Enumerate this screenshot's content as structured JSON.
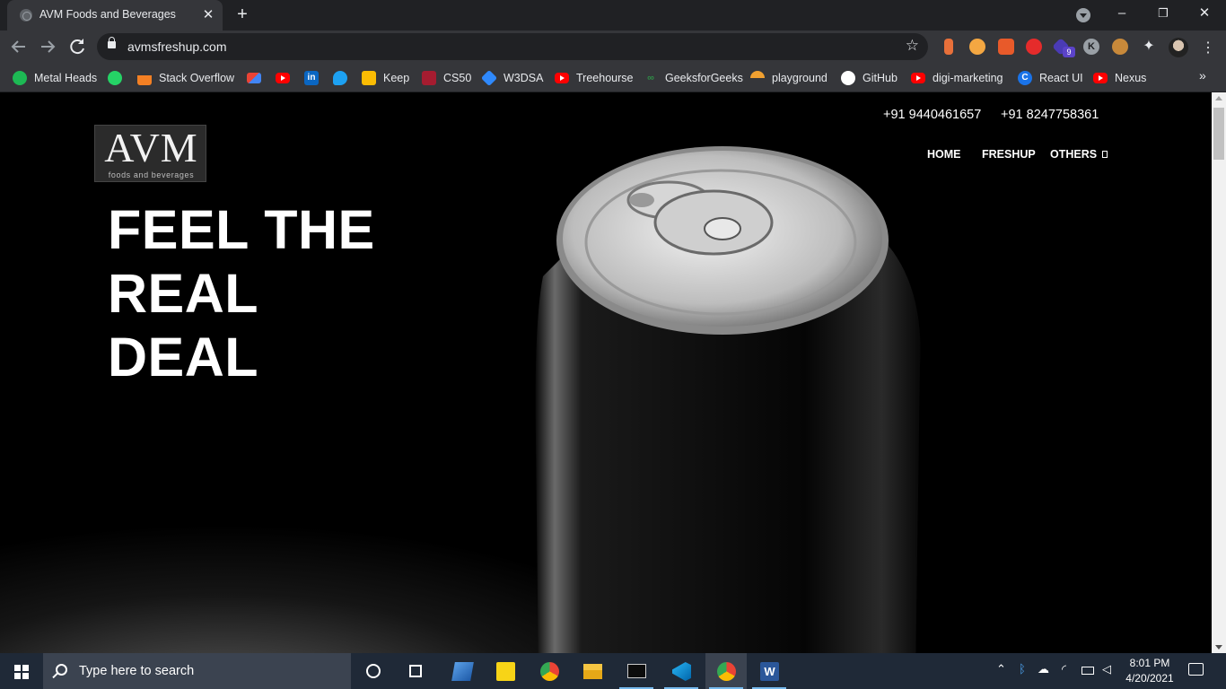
{
  "browser": {
    "tab_title": "AVM Foods and Beverages",
    "tab_close": "✕",
    "new_tab": "+",
    "url": "avmsfreshup.com",
    "extension_badge": "9",
    "extension_k": "K",
    "window_controls": [
      "–",
      "❐",
      "✕"
    ],
    "nav_icons": [
      "arrow-left-icon",
      "arrow-right-icon",
      "reload-icon"
    ]
  },
  "bookmarks": [
    {
      "label": "Metal Heads",
      "icon": "spotify-icon",
      "color": "#1db954"
    },
    {
      "label": "",
      "icon": "whatsapp-icon",
      "color": "#25d366"
    },
    {
      "label": "Stack Overflow",
      "icon": "stackoverflow-icon",
      "color": "#f48024"
    },
    {
      "label": "",
      "icon": "gmail-icon",
      "color": "#ea4335"
    },
    {
      "label": "",
      "icon": "youtube-icon",
      "color": "#ff0000"
    },
    {
      "label": "",
      "icon": "linkedin-icon",
      "color": "#0a66c2"
    },
    {
      "label": "",
      "icon": "twitter-icon",
      "color": "#1da1f2"
    },
    {
      "label": "Keep",
      "icon": "keep-icon",
      "color": "#fbbc04"
    },
    {
      "label": "CS50",
      "icon": "cs50-icon",
      "color": "#a51c30"
    },
    {
      "label": "W3DSA",
      "icon": "w3dsa-icon",
      "color": "#2f89fc"
    },
    {
      "label": "Treehourse",
      "icon": "youtube-icon",
      "color": "#ff0000"
    },
    {
      "label": "GeeksforGeeks",
      "icon": "geeksforgeeks-icon",
      "color": "#2f8d46"
    },
    {
      "label": "playground",
      "icon": "playground-icon",
      "color": "#f0a030"
    },
    {
      "label": "GitHub",
      "icon": "github-icon",
      "color": "#ffffff"
    },
    {
      "label": "digi-marketing",
      "icon": "youtube-icon",
      "color": "#ff0000"
    },
    {
      "label": "React UI",
      "icon": "react-ui-icon",
      "color": "#1a73e8"
    },
    {
      "label": "Nexus",
      "icon": "youtube-icon",
      "color": "#ff0000"
    }
  ],
  "bookmarks_more": "»",
  "site": {
    "logo_mark": "AVM",
    "logo_sub": "foods and beverages",
    "phone_1": "+91 9440461657",
    "phone_2": "+91 8247758361",
    "nav": {
      "home": "HOME",
      "freshup": "FRESHUP",
      "others": "OTHERS"
    },
    "hero_line_1": "FEEL THE REAL",
    "hero_line_2": "DEAL"
  },
  "taskbar": {
    "search_placeholder": "Type here to search",
    "time": "8:01 PM",
    "date": "4/20/2021",
    "apps": [
      "cortana-icon",
      "task-view-icon",
      "desktop-icon",
      "sticky-notes-icon",
      "chrome-icon",
      "file-explorer-icon",
      "terminal-icon",
      "vscode-icon",
      "chrome-icon",
      "word-icon"
    ],
    "colors": {
      "accent": "#76b9ed",
      "bar": "#1f2937"
    }
  }
}
